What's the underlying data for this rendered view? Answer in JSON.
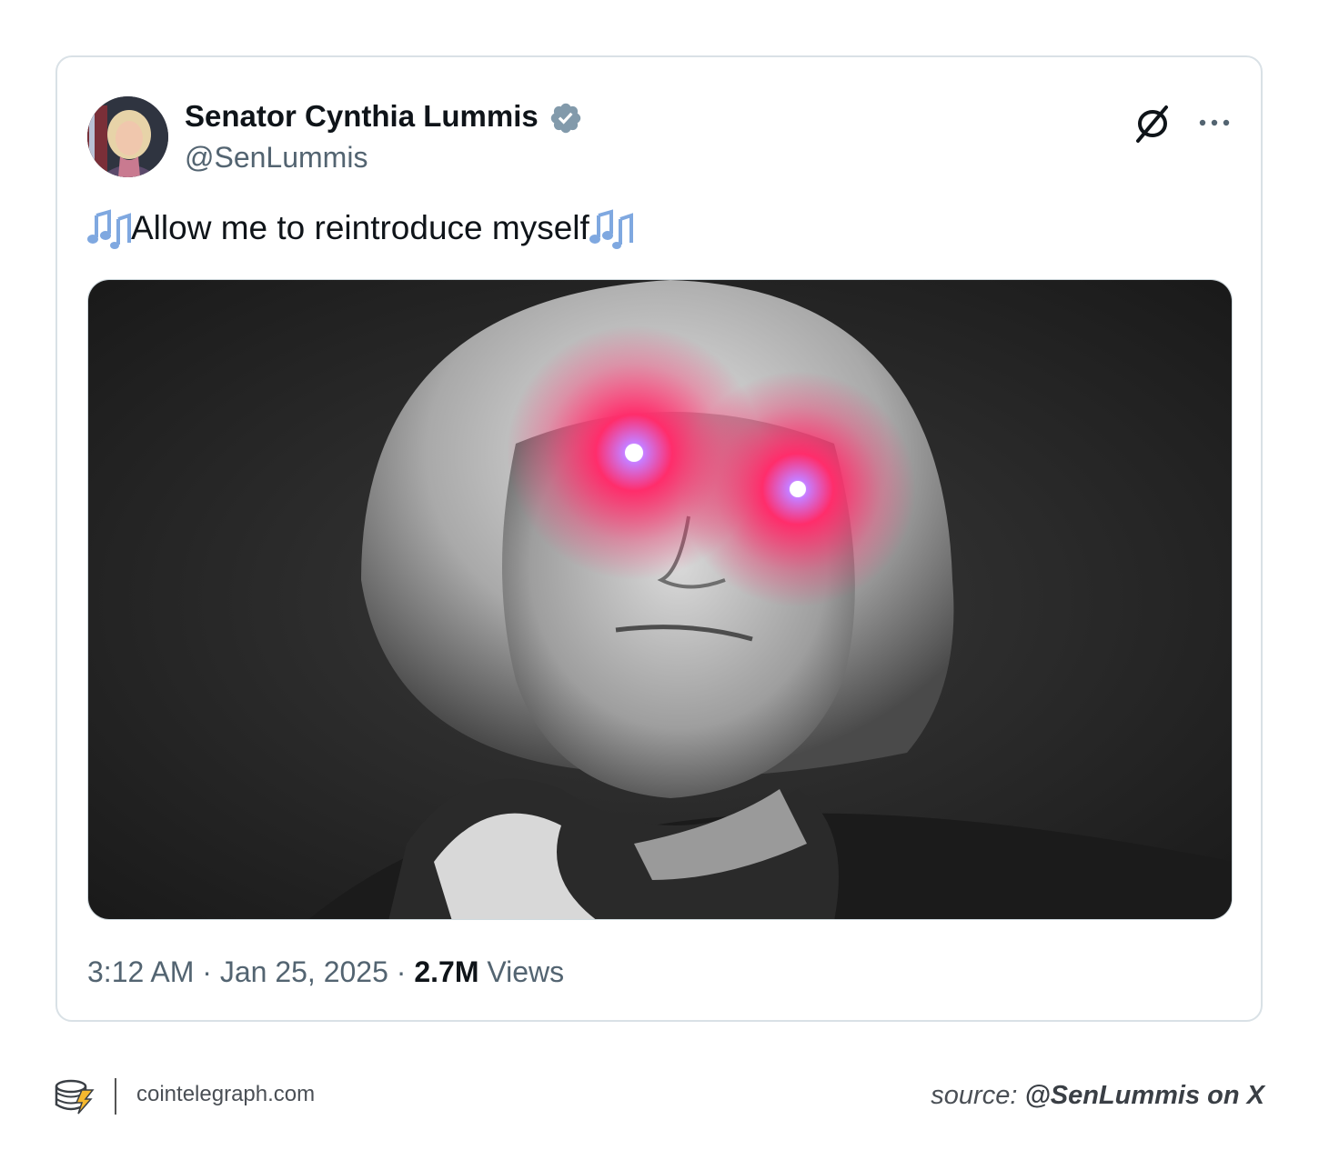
{
  "tweet": {
    "display_name": "Senator Cynthia Lummis",
    "handle": "@SenLummis",
    "text": "Allow me to reintroduce myself",
    "time": "3:12 AM",
    "separator": "·",
    "date": "Jan 25, 2025",
    "views_count": "2.7M",
    "views_label": "Views"
  },
  "icons": {
    "verified": "verified-badge-icon",
    "platform": "x-logo-icon",
    "more": "more-options-icon",
    "music": "musical-notes-emoji"
  },
  "footer": {
    "site": "cointelegraph.com",
    "source_prefix": "source:",
    "source_handle": "@SenLummis on X"
  },
  "colors": {
    "verified_badge": "#829aab",
    "eye_glow": "#ff2d6b",
    "notes": "#7fa8e0",
    "logo_accent": "#f5b82e"
  }
}
